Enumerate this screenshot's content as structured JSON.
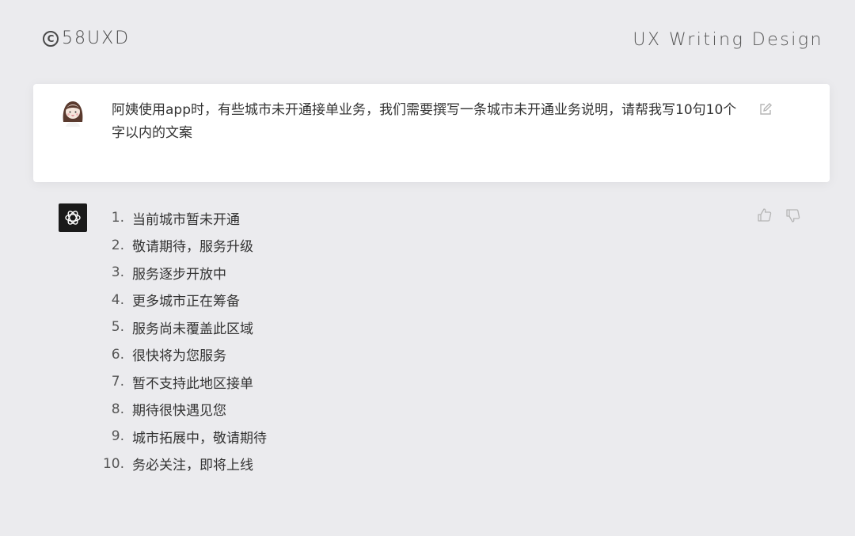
{
  "header": {
    "brand": "58UXD",
    "copyright_symbol": "C",
    "tagline": "UX Writing Design"
  },
  "user_message": {
    "avatar": "woman-avatar-icon",
    "text": "阿姨使用app时，有些城市未开通接单业务，我们需要撰写一条城市未开通业务说明，请帮我写10句10个字以内的文案"
  },
  "assistant": {
    "icon": "openai-logo-icon",
    "items": [
      {
        "num": "1.",
        "text": "当前城市暂未开通"
      },
      {
        "num": "2.",
        "text": "敬请期待，服务升级"
      },
      {
        "num": "3.",
        "text": "服务逐步开放中"
      },
      {
        "num": "4.",
        "text": "更多城市正在筹备"
      },
      {
        "num": "5.",
        "text": "服务尚未覆盖此区域"
      },
      {
        "num": "6.",
        "text": "很快将为您服务"
      },
      {
        "num": "7.",
        "text": "暂不支持此地区接单"
      },
      {
        "num": "8.",
        "text": "期待很快遇见您"
      },
      {
        "num": "9.",
        "text": "城市拓展中，敬请期待"
      },
      {
        "num": "10.",
        "text": "务必关注，即将上线"
      }
    ]
  },
  "colors": {
    "background": "#ebebee",
    "card": "#ffffff",
    "bot_icon_bg": "#1a1a1a",
    "icon_gray": "#b5b5b5"
  }
}
